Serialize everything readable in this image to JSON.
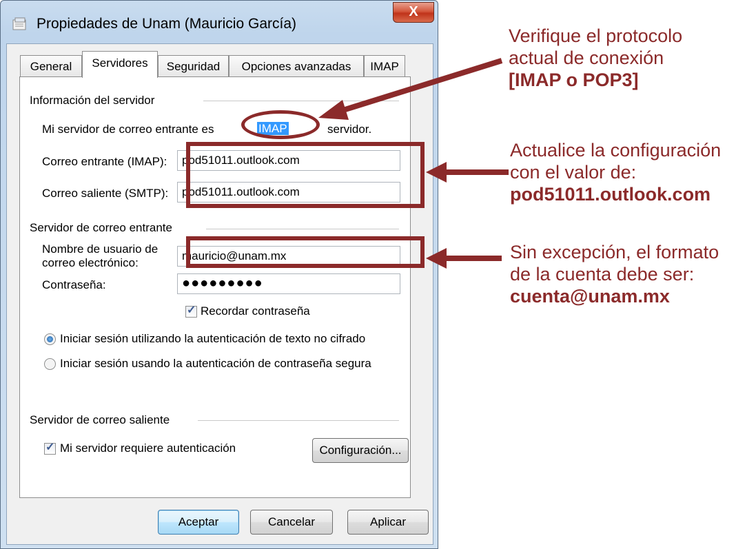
{
  "window": {
    "title": "Propiedades de Unam (Mauricio García)",
    "close_label": "X"
  },
  "tabs": [
    {
      "label": "General"
    },
    {
      "label": "Servidores"
    },
    {
      "label": "Seguridad"
    },
    {
      "label": "Opciones avanzadas"
    },
    {
      "label": "IMAP"
    }
  ],
  "server_info": {
    "group_label": "Información del servidor",
    "incoming_type_prefix": "Mi servidor de correo entrante es",
    "incoming_type_value": "IMAP",
    "incoming_type_suffix": "servidor.",
    "incoming_label": "Correo entrante (IMAP):",
    "incoming_value": "pod51011.outlook.com",
    "outgoing_label": "Correo saliente (SMTP):",
    "outgoing_value": "pod51011.outlook.com"
  },
  "incoming_server": {
    "group_label": "Servidor de correo entrante",
    "username_label_line1": "Nombre de usuario de",
    "username_label_line2": "correo electrónico:",
    "username_value": "mauricio@unam.mx",
    "password_label": "Contraseña:",
    "password_value": "●●●●●●●●●",
    "remember_label": "Recordar contraseña",
    "radio_plain": "Iniciar sesión utilizando la autenticación de texto no cifrado",
    "radio_secure": "Iniciar sesión usando la autenticación de contraseña segura"
  },
  "outgoing_server": {
    "group_label": "Servidor de correo saliente",
    "requires_auth_label": "Mi servidor requiere autenticación",
    "config_button": "Configuración..."
  },
  "buttons": {
    "accept": "Aceptar",
    "cancel": "Cancelar",
    "apply": "Aplicar"
  },
  "annotations": {
    "note1_line1": "Verifique el protocolo",
    "note1_line2": "actual de conexión",
    "note1_bold": "[IMAP o POP3]",
    "note2_line1": "Actualice la configuración",
    "note2_line2": "con el valor de:",
    "note2_bold": "pod51011.outlook.com",
    "note3_line1": "Sin excepción, el formato",
    "note3_line2": "de la cuenta debe ser:",
    "note3_bold": "cuenta@unam.mx",
    "color": "#8b2a2a"
  }
}
